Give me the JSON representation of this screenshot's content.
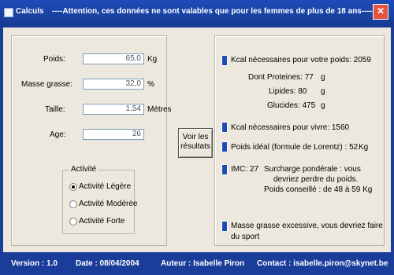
{
  "window": {
    "title": "Calculs",
    "message": "----Attention, ces données ne sont valables que pour les femmes de plus de 18 ans-----"
  },
  "inputs": {
    "poids": {
      "label": "Poids:",
      "value": "65,0",
      "unit": "Kg"
    },
    "masse_grasse": {
      "label": "Masse grasse:",
      "value": "32,0",
      "unit": "%"
    },
    "taille": {
      "label": "Taille:",
      "value": "1,54",
      "unit": "Mètres"
    },
    "age": {
      "label": "Age:",
      "value": "26"
    }
  },
  "activite": {
    "title": "Activité",
    "options": [
      "Activité Légère",
      "Activité Modérée",
      "Activité Forte"
    ],
    "selected_index": 0
  },
  "button": {
    "line1": "Voir les",
    "line2": "résultats"
  },
  "results": {
    "kcal_poids": "Kcal nécessaires pour votre poids: 2059",
    "proteines_label": "Dont Proteines: 77",
    "proteines_unit": "g",
    "lipides_label": "Lipides: 80",
    "lipides_unit": "g",
    "glucides_label": "Glucides: 475",
    "glucides_unit": "g",
    "kcal_vivre": "Kcal nécessaires pour vivre: 1560",
    "poids_ideal": "Poids idéal (formule de Lorentz) : 52",
    "poids_ideal_unit": "Kg",
    "imc_label": "IMC: 27",
    "imc_text_1": "Surcharge pondérale : vous",
    "imc_text_2": "devriez perdre du poids.",
    "imc_text_3": "Poids conseillé : de 48 à 59 Kg",
    "masse_1": "Masse grasse excessive, vous devriez faire",
    "masse_2": "du sport"
  },
  "status": {
    "version": "Version : 1.0",
    "date": "Date : 08/04/2004",
    "auteur": "Auteur : Isabelle Piron",
    "contact": "Contact : isabelle.piron@skynet.be"
  },
  "colors": {
    "title_bar": "#1b3d9a",
    "window_bg": "#ece8dd",
    "accent": "#1d4bb8"
  }
}
